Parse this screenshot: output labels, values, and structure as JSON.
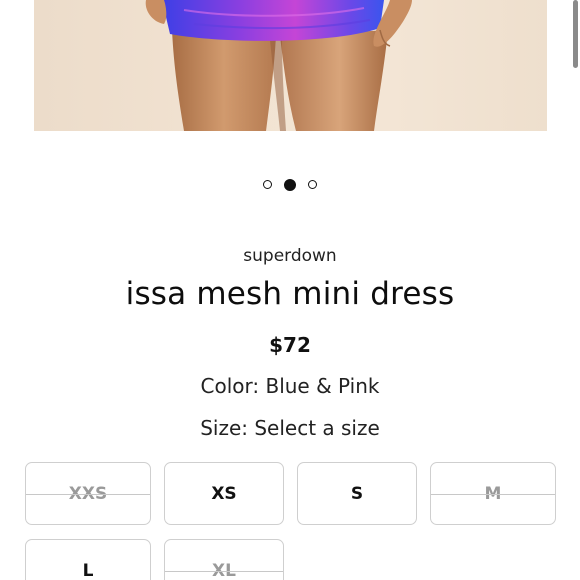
{
  "product": {
    "brand": "superdown",
    "name": "issa mesh mini dress",
    "price": "$72",
    "color_line": "Color: Blue & Pink",
    "size_line": "Size: Select a size"
  },
  "carousel": {
    "slide_count": 3,
    "active_index": 1
  },
  "sizes": [
    {
      "label": "XXS",
      "available": false
    },
    {
      "label": "XS",
      "available": true
    },
    {
      "label": "S",
      "available": true
    },
    {
      "label": "M",
      "available": false
    },
    {
      "label": "L",
      "available": true
    },
    {
      "label": "XL",
      "available": false
    }
  ],
  "colors": {
    "dress_blue": "#3b4fe0",
    "dress_pink": "#b93fd8",
    "background": "#f2e3d2",
    "skin": "#c98e62"
  }
}
